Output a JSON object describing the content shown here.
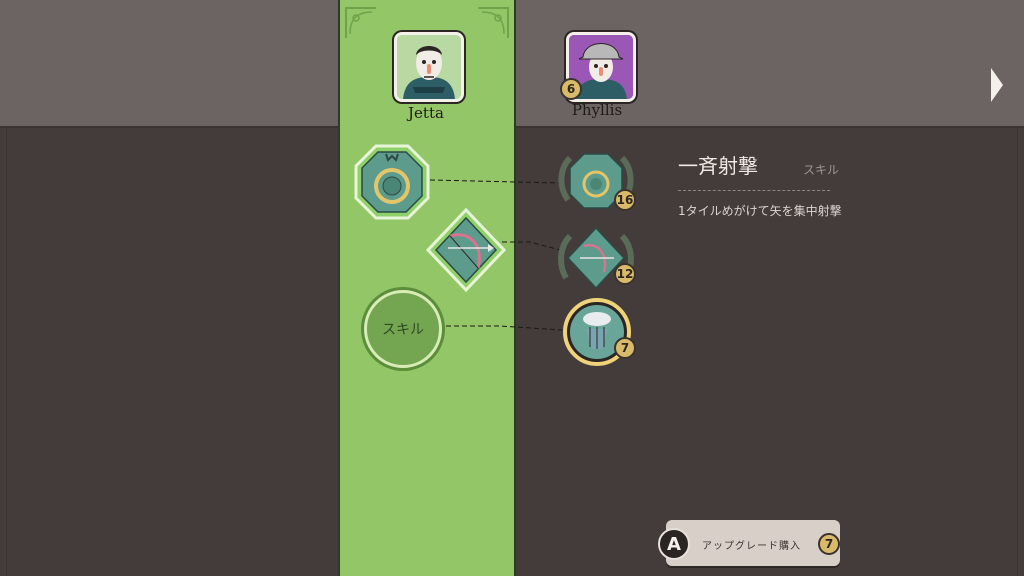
{
  "heroes": [
    {
      "name": "Jetta"
    },
    {
      "name": "Phyllis",
      "level": "6"
    }
  ],
  "upgrades": [
    {
      "id": "ring",
      "cost": "16"
    },
    {
      "id": "bow",
      "cost": "12"
    },
    {
      "id": "volley",
      "cost": "7"
    }
  ],
  "skill_slot": {
    "label": "スキル"
  },
  "info": {
    "title": "一斉射撃",
    "tag": "スキル",
    "description": "1タイルめがけて矢を集中射撃"
  },
  "buy": {
    "key": "A",
    "label": "アップグレード購入",
    "cost": "7"
  },
  "colors": {
    "green_column": "#93c667",
    "topbar": "#6b6462",
    "background": "#433c3a",
    "gem_teal": "#5d9b8c",
    "gold": "#d9b96a"
  }
}
